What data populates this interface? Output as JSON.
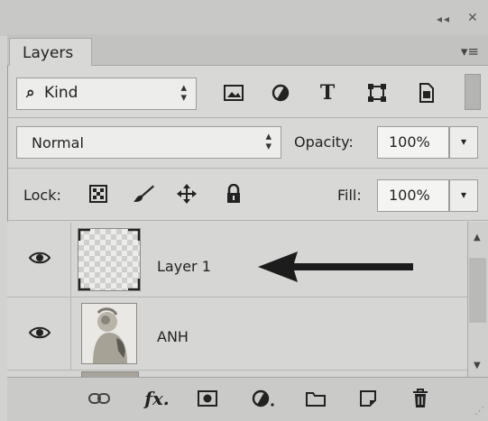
{
  "window": {
    "collapse_icon": "double-chevron-left-icon",
    "close_icon": "close-icon"
  },
  "panel": {
    "tab_label": "Layers",
    "menu_icon": "panel-menu-icon"
  },
  "filter": {
    "kind_label": "Kind",
    "filter_icons": [
      "pixel-filter-icon",
      "adjustment-filter-icon",
      "type-filter-icon",
      "shape-filter-icon",
      "smart-object-filter-icon"
    ]
  },
  "blend": {
    "mode": "Normal",
    "opacity_label": "Opacity:",
    "opacity_value": "100%"
  },
  "lock": {
    "label": "Lock:",
    "icons": [
      "lock-transparent-pixels-icon",
      "lock-image-pixels-icon",
      "lock-position-icon",
      "lock-all-icon"
    ],
    "fill_label": "Fill:",
    "fill_value": "100%"
  },
  "layers": [
    {
      "name": "Layer 1",
      "visible": true,
      "thumbnail": "transparent",
      "selected": true
    },
    {
      "name": "ANH",
      "visible": true,
      "thumbnail": "photo"
    }
  ],
  "annotation": {
    "arrow_color": "#1c1c1c"
  },
  "footer_icons": [
    "link-layers-icon",
    "layer-style-icon",
    "layer-mask-icon",
    "adjustment-layer-icon",
    "group-folder-icon",
    "new-layer-icon",
    "delete-trash-icon"
  ]
}
